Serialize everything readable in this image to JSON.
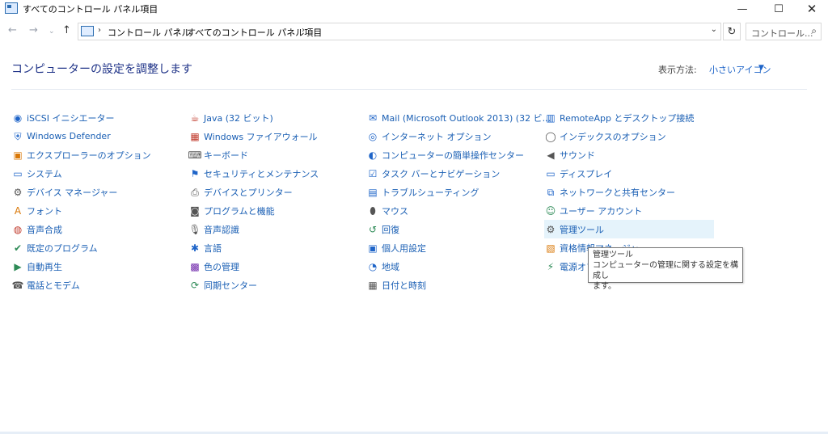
{
  "window": {
    "title": "すべてのコントロール パネル項目",
    "min_glyph": "—",
    "max_glyph": "☐",
    "close_glyph": "✕"
  },
  "nav": {
    "back_glyph": "←",
    "forward_glyph": "→",
    "recent_glyph": "⌄",
    "up_glyph": "↑"
  },
  "address": {
    "breadcrumbs": [
      "コントロール パネル",
      "すべてのコントロール パネル項目"
    ],
    "sep_glyph": "›",
    "dropdown_glyph": "⌄",
    "refresh_glyph": "↻"
  },
  "search": {
    "placeholder": "コントロール...",
    "icon_glyph": "⌕"
  },
  "header": {
    "heading": "コンピューターの設定を調整します",
    "view_by_label": "表示方法:",
    "view_by_value": "小さいアイコン",
    "view_by_caret": "▼"
  },
  "columns": [
    [
      {
        "label": "iSCSI イニシエーター",
        "icon": "globe-icon",
        "glyph": "◉"
      },
      {
        "label": "Windows Defender",
        "icon": "shield-icon",
        "glyph": "⛨"
      },
      {
        "label": "エクスプローラーのオプション",
        "icon": "folder-icon",
        "glyph": "▣"
      },
      {
        "label": "システム",
        "icon": "monitor-icon",
        "glyph": "▭"
      },
      {
        "label": "デバイス マネージャー",
        "icon": "device-icon",
        "glyph": "⚙"
      },
      {
        "label": "フォント",
        "icon": "font-icon",
        "glyph": "A"
      },
      {
        "label": "音声合成",
        "icon": "speech-icon",
        "glyph": "◍"
      },
      {
        "label": "既定のプログラム",
        "icon": "check-icon",
        "glyph": "✔"
      },
      {
        "label": "自動再生",
        "icon": "autoplay-icon",
        "glyph": "▶"
      },
      {
        "label": "電話とモデム",
        "icon": "phone-icon",
        "glyph": "☎"
      }
    ],
    [
      {
        "label": "Java (32 ビット)",
        "icon": "java-icon",
        "glyph": "☕"
      },
      {
        "label": "Windows ファイアウォール",
        "icon": "firewall-icon",
        "glyph": "▦"
      },
      {
        "label": "キーボード",
        "icon": "keyboard-icon",
        "glyph": "⌨"
      },
      {
        "label": "セキュリティとメンテナンス",
        "icon": "flag-icon",
        "glyph": "⚑"
      },
      {
        "label": "デバイスとプリンター",
        "icon": "printer-icon",
        "glyph": "⎙"
      },
      {
        "label": "プログラムと機能",
        "icon": "programs-icon",
        "glyph": "◙"
      },
      {
        "label": "音声認識",
        "icon": "microphone-icon",
        "glyph": "🎙"
      },
      {
        "label": "言語",
        "icon": "language-icon",
        "glyph": "✱"
      },
      {
        "label": "色の管理",
        "icon": "color-icon",
        "glyph": "▩"
      },
      {
        "label": "同期センター",
        "icon": "sync-icon",
        "glyph": "⟳"
      }
    ],
    [
      {
        "label": "Mail (Microsoft Outlook 2013) (32 ビ...",
        "icon": "mail-icon",
        "glyph": "✉"
      },
      {
        "label": "インターネット オプション",
        "icon": "internet-icon",
        "glyph": "◎"
      },
      {
        "label": "コンピューターの簡単操作センター",
        "icon": "accessibility-icon",
        "glyph": "◐"
      },
      {
        "label": "タスク バーとナビゲーション",
        "icon": "taskbar-icon",
        "glyph": "☑"
      },
      {
        "label": "トラブルシューティング",
        "icon": "troubleshoot-icon",
        "glyph": "▤"
      },
      {
        "label": "マウス",
        "icon": "mouse-icon",
        "glyph": "⬮"
      },
      {
        "label": "回復",
        "icon": "recovery-icon",
        "glyph": "↺"
      },
      {
        "label": "個人用設定",
        "icon": "personalize-icon",
        "glyph": "▣"
      },
      {
        "label": "地域",
        "icon": "region-icon",
        "glyph": "◔"
      },
      {
        "label": "日付と時刻",
        "icon": "calendar-icon",
        "glyph": "▦"
      }
    ],
    [
      {
        "label": "RemoteApp とデスクトップ接続",
        "icon": "remoteapp-icon",
        "glyph": "▥"
      },
      {
        "label": "インデックスのオプション",
        "icon": "index-icon",
        "glyph": "◯"
      },
      {
        "label": "サウンド",
        "icon": "speaker-icon",
        "glyph": "◀"
      },
      {
        "label": "ディスプレイ",
        "icon": "display-icon",
        "glyph": "▭"
      },
      {
        "label": "ネットワークと共有センター",
        "icon": "network-icon",
        "glyph": "⧉"
      },
      {
        "label": "ユーザー アカウント",
        "icon": "users-icon",
        "glyph": "☺"
      },
      {
        "label": "管理ツール",
        "icon": "admin-tools-icon",
        "glyph": "⚙"
      },
      {
        "label": "資格情報マネージャー",
        "icon": "credential-icon",
        "glyph": "▧"
      },
      {
        "label": "電源オプション",
        "icon": "power-icon",
        "glyph": "⚡"
      }
    ]
  ],
  "tooltip": {
    "title": "管理ツール",
    "line1": "コンピューターの管理に関する設定を構成し",
    "line2": "ます。"
  }
}
